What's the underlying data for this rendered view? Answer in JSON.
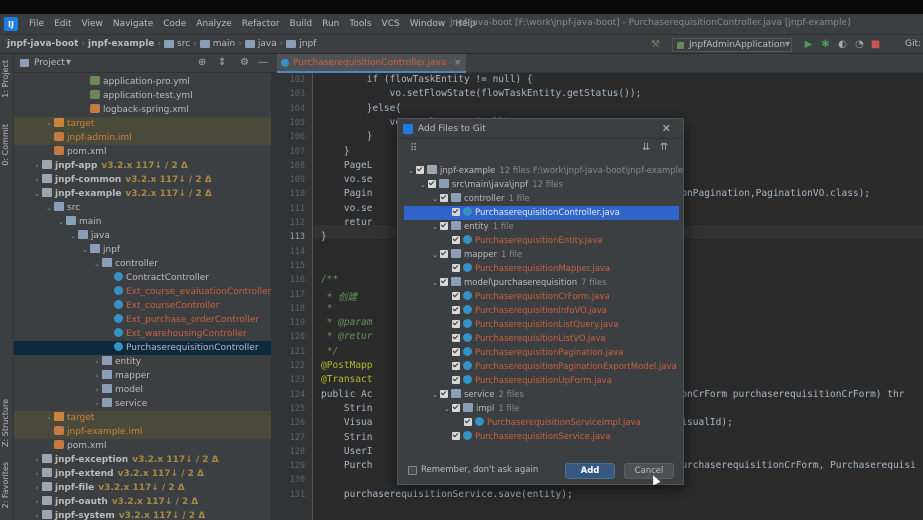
{
  "menubar": {
    "items": [
      "File",
      "Edit",
      "View",
      "Navigate",
      "Code",
      "Analyze",
      "Refactor",
      "Build",
      "Run",
      "Tools",
      "VCS",
      "Window",
      "Help"
    ],
    "window_title": "jnpf-java-boot [F:\\work\\jnpf-java-boot] - PurchaserequisitionController.java [jnpf-example]"
  },
  "navbar": {
    "crumbs": [
      "jnpf-java-boot",
      "jnpf-example",
      "src",
      "main",
      "java",
      "jnpf"
    ],
    "run_config": "JnpfAdminApplication",
    "git_label": "Git:"
  },
  "sidebar_stripe": {
    "project": "1: Project",
    "commit": "0: Commit",
    "structure": "Z: Structure",
    "favorites": "2: Favorites"
  },
  "project_panel": {
    "title": "Project",
    "rows": [
      {
        "text": "application-pro.yml",
        "icon": "file-yml",
        "indent": 5,
        "color": "white"
      },
      {
        "text": "application-test.yml",
        "icon": "file-yml",
        "indent": 5,
        "color": "white"
      },
      {
        "text": "logback-spring.xml",
        "icon": "file-xml",
        "indent": 5,
        "color": "white"
      },
      {
        "text": "target",
        "icon": "folder-orange",
        "indent": 2,
        "color": "orange",
        "twisty": "›",
        "hl": true
      },
      {
        "text": "jnpf-admin.iml",
        "icon": "file-xml",
        "indent": 2,
        "color": "orange",
        "hl": true
      },
      {
        "text": "pom.xml",
        "icon": "file-xml",
        "indent": 2,
        "color": "white"
      },
      {
        "text": "jnpf-app",
        "icon": "module",
        "indent": 1,
        "color": "white",
        "twisty": "›",
        "bold": true,
        "ver": "v3.2.x 117↓ / 2 Δ"
      },
      {
        "text": "jnpf-common",
        "icon": "module",
        "indent": 1,
        "color": "white",
        "twisty": "›",
        "bold": true,
        "ver": "v3.2.x 117↓ / 2 Δ"
      },
      {
        "text": "jnpf-example",
        "icon": "module",
        "indent": 1,
        "color": "white",
        "twisty": "⌄",
        "bold": true,
        "ver": "v3.2.x 117↓ / 2 Δ"
      },
      {
        "text": "src",
        "icon": "folder",
        "indent": 2,
        "color": "white",
        "twisty": "⌄"
      },
      {
        "text": "main",
        "icon": "folder",
        "indent": 3,
        "color": "white",
        "twisty": "⌄"
      },
      {
        "text": "java",
        "icon": "folder",
        "indent": 4,
        "color": "white",
        "twisty": "⌄"
      },
      {
        "text": "jnpf",
        "icon": "folder",
        "indent": 5,
        "color": "white",
        "twisty": "⌄"
      },
      {
        "text": "controller",
        "icon": "folder",
        "indent": 6,
        "color": "white",
        "twisty": "⌄"
      },
      {
        "text": "ContractController",
        "icon": "cls",
        "indent": 7,
        "color": "white"
      },
      {
        "text": "Ext_course_evaluationController",
        "icon": "cls",
        "indent": 7,
        "color": "red"
      },
      {
        "text": "Ext_courseController",
        "icon": "cls",
        "indent": 7,
        "color": "red"
      },
      {
        "text": "Ext_purchase_orderController",
        "icon": "cls",
        "indent": 7,
        "color": "red"
      },
      {
        "text": "Ext_warehousingController",
        "icon": "cls",
        "indent": 7,
        "color": "red"
      },
      {
        "text": "PurchaserequisitionController",
        "icon": "cls",
        "indent": 7,
        "color": "white",
        "selected": true
      },
      {
        "text": "entity",
        "icon": "folder",
        "indent": 6,
        "color": "white",
        "twisty": "›"
      },
      {
        "text": "mapper",
        "icon": "folder",
        "indent": 6,
        "color": "white",
        "twisty": "›"
      },
      {
        "text": "model",
        "icon": "folder",
        "indent": 6,
        "color": "white",
        "twisty": "›"
      },
      {
        "text": "service",
        "icon": "folder",
        "indent": 6,
        "color": "white",
        "twisty": "›"
      },
      {
        "text": "target",
        "icon": "folder-orange",
        "indent": 2,
        "color": "orange",
        "twisty": "›",
        "hl": true
      },
      {
        "text": "jnpf-example.iml",
        "icon": "file-xml",
        "indent": 2,
        "color": "orange",
        "hl": true
      },
      {
        "text": "pom.xml",
        "icon": "file-xml",
        "indent": 2,
        "color": "white"
      },
      {
        "text": "jnpf-exception",
        "icon": "module",
        "indent": 1,
        "color": "white",
        "twisty": "›",
        "bold": true,
        "ver": "v3.2.x 117↓ / 2 Δ"
      },
      {
        "text": "jnpf-extend",
        "icon": "module",
        "indent": 1,
        "color": "white",
        "twisty": "›",
        "bold": true,
        "ver": "v3.2.x 117↓ / 2 Δ"
      },
      {
        "text": "jnpf-file",
        "icon": "module",
        "indent": 1,
        "color": "white",
        "twisty": "›",
        "bold": true,
        "ver": "v3.2.x 117↓ / 2 Δ"
      },
      {
        "text": "jnpf-oauth",
        "icon": "module",
        "indent": 1,
        "color": "white",
        "twisty": "›",
        "bold": true,
        "ver": "v3.2.x 117↓ / 2 Δ"
      },
      {
        "text": "jnpf-system",
        "icon": "module",
        "indent": 1,
        "color": "white",
        "twisty": "›",
        "bold": true,
        "ver": "v3.2.x 117↓ / 2 Δ"
      }
    ]
  },
  "editor": {
    "tab_label": "PurchaserequisitionController.java",
    "line_numbers": [
      "102",
      "103",
      "104",
      "105",
      "106",
      "107",
      "108",
      "109",
      "110",
      "111",
      "112",
      "113",
      "114",
      "115",
      "116",
      "117",
      "118",
      "119",
      "120",
      "121",
      "122",
      "123",
      "124",
      "125",
      "126",
      "127",
      "128",
      "129",
      "130",
      "131"
    ],
    "current_line": "113",
    "code_lines": [
      "        if (flowTaskEntity != null) {",
      "            vo.setFlowState(flowTaskEntity.getStatus());",
      "        }else{",
      "            vo.setFlowState(null);",
      "        }",
      "    }",
      "    PageL",
      "    vo.se",
      "    Pagin                                                   itionPagination,PaginationVO.class);",
      "    vo.se",
      "    retur",
      "}",
      "",
      "",
      "/**",
      " * 创建",
      " *",
      " * @param",
      " * @retur",
      " */",
      "@PostMapp",
      "@Transact",
      "public Ac                                                   itionCrForm purchaserequisitionCrForm) thr",
      "    Strin",
      "    Visua                                                   o(visualId);",
      "    Strin",
      "    UserI",
      "    Purch                                                   n(purchaserequisitionCrForm, Purchaserequisi",
      "",
      "    purchaserequisitionService.save(entity);"
    ]
  },
  "dialog": {
    "title": "Add Files to Git",
    "rows": [
      {
        "text": "jnpf-example",
        "dim": "12 files F:\\work\\jnpf-java-boot\\jnpf-example",
        "indent": 0,
        "twisty": "⌄",
        "icon": "module"
      },
      {
        "text": "src\\main\\java\\jnpf",
        "dim": "12 files",
        "indent": 1,
        "twisty": "⌄",
        "icon": "folder"
      },
      {
        "text": "controller",
        "dim": "1 file",
        "indent": 2,
        "twisty": "⌄",
        "icon": "folder"
      },
      {
        "text": "PurchaserequisitionController.java",
        "indent": 3,
        "icon": "cls",
        "java": true,
        "selected": true
      },
      {
        "text": "entity",
        "dim": "1 file",
        "indent": 2,
        "twisty": "⌄",
        "icon": "folder"
      },
      {
        "text": "PurchaserequisitionEntity.java",
        "indent": 3,
        "icon": "cls",
        "java": true
      },
      {
        "text": "mapper",
        "dim": "1 file",
        "indent": 2,
        "twisty": "⌄",
        "icon": "folder"
      },
      {
        "text": "PurchaserequisitionMapper.java",
        "indent": 3,
        "icon": "cls",
        "java": true
      },
      {
        "text": "model\\purchaserequisition",
        "dim": "7 files",
        "indent": 2,
        "twisty": "⌄",
        "icon": "folder"
      },
      {
        "text": "PurchaserequisitionCrForm.java",
        "indent": 3,
        "icon": "cls",
        "java": true
      },
      {
        "text": "PurchaserequisitionInfoVO.java",
        "indent": 3,
        "icon": "cls",
        "java": true
      },
      {
        "text": "PurchaserequisitionListQuery.java",
        "indent": 3,
        "icon": "cls",
        "java": true
      },
      {
        "text": "PurchaserequisitionListVO.java",
        "indent": 3,
        "icon": "cls",
        "java": true
      },
      {
        "text": "PurchaserequisitionPagination.java",
        "indent": 3,
        "icon": "cls",
        "java": true
      },
      {
        "text": "PurchaserequisitionPaginationExportModel.java",
        "indent": 3,
        "icon": "cls",
        "java": true
      },
      {
        "text": "PurchaserequisitionUpForm.java",
        "indent": 3,
        "icon": "cls",
        "java": true
      },
      {
        "text": "service",
        "dim": "2 files",
        "indent": 2,
        "twisty": "⌄",
        "icon": "folder"
      },
      {
        "text": "impl",
        "dim": "1 file",
        "indent": 3,
        "twisty": "⌄",
        "icon": "folder"
      },
      {
        "text": "PurchaserequisitionServiceImpl.java",
        "indent": 4,
        "icon": "cls",
        "java": true
      },
      {
        "text": "PurchaserequisitionService.java",
        "indent": 3,
        "icon": "cls",
        "java": true
      }
    ],
    "remember_label": "Remember, don't ask again",
    "add_label": "Add",
    "cancel_label": "Cancel"
  },
  "colors": {
    "accent": "#2f65ca",
    "java_file": "#c9613f",
    "ignored": "#d0803a"
  }
}
